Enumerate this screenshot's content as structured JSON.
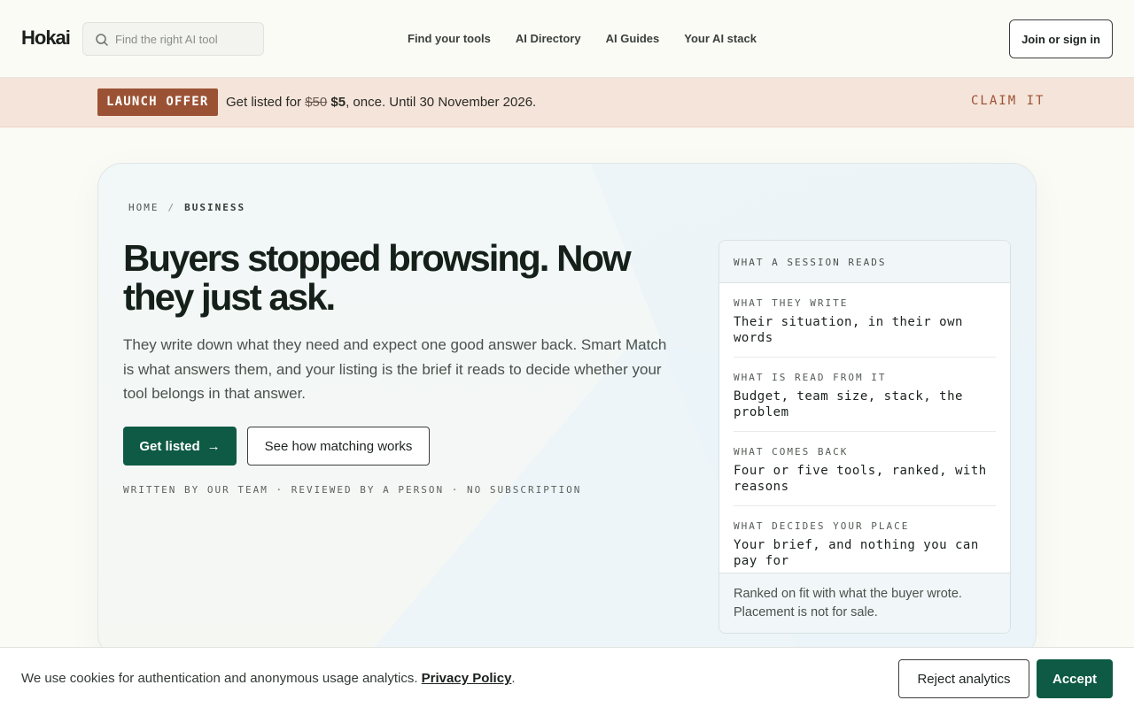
{
  "header": {
    "logo": "Hokai",
    "search_placeholder": "Find the right AI tool",
    "nav": [
      "Find your tools",
      "AI Directory",
      "AI Guides",
      "Your AI stack"
    ],
    "signin_label": "Join or sign in"
  },
  "promo": {
    "badge": "LAUNCH OFFER",
    "text_prefix": "Get listed for ",
    "old_price": "$50",
    "new_price": "$5",
    "text_suffix": ", once. Until 30 November 2026.",
    "claim_label": "CLAIM IT"
  },
  "hero": {
    "breadcrumb": {
      "home": "HOME",
      "separator": "/",
      "current": "BUSINESS"
    },
    "title": "Buyers stopped browsing. Now they just ask.",
    "lead": "They write down what they need and expect one good answer back. Smart Match is what answers them, and your listing is the brief it reads to decide whether your tool belongs in that answer.",
    "primary_label": "Get listed",
    "secondary_label": "See how matching works",
    "tagline": "WRITTEN BY OUR TEAM · REVIEWED BY A PERSON · NO SUBSCRIPTION"
  },
  "panel": {
    "title": "WHAT A SESSION READS",
    "rows": [
      {
        "label": "WHAT THEY WRITE",
        "value": "Their situation, in their own words"
      },
      {
        "label": "WHAT IS READ FROM IT",
        "value": "Budget, team size, stack, the problem"
      },
      {
        "label": "WHAT COMES BACK",
        "value": "Four or five tools, ranked, with reasons"
      },
      {
        "label": "WHAT DECIDES YOUR PLACE",
        "value": "Your brief, and nothing you can pay for"
      }
    ],
    "footer": "Ranked on fit with what the buyer wrote. Placement is not for sale."
  },
  "cookie": {
    "text": "We use cookies for authentication and anonymous usage analytics. ",
    "policy_link": "Privacy Policy",
    "trail": ".",
    "reject_label": "Reject analytics",
    "accept_label": "Accept"
  },
  "colors": {
    "brand": "#0e5a44",
    "promo_bg": "#f5e4d9",
    "promo_accent": "#9b5234"
  }
}
